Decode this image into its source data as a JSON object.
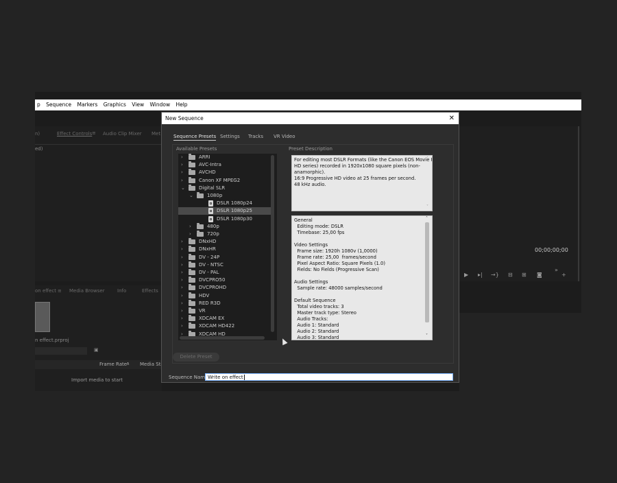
{
  "menubar": {
    "items": [
      "p",
      "Sequence",
      "Markers",
      "Graphics",
      "View",
      "Window",
      "Help"
    ]
  },
  "background": {
    "panel_tabs_top": [
      "n)",
      "Effect Controls",
      "Audio Clip Mixer",
      "Met"
    ],
    "panel_top_label": "ed)",
    "panel_tabs_bottom": [
      "on effect",
      "Media Browser",
      "Info",
      "Effects"
    ],
    "project_file": "n effect.prproj",
    "column_frame_rate": "Frame Rate",
    "column_media_start": "Media Star",
    "import_hint": "Import media to start",
    "timecode": "00;00;00;00"
  },
  "dialog": {
    "title": "New Sequence",
    "close": "✕",
    "tabs": [
      "Sequence Presets",
      "Settings",
      "Tracks",
      "VR Video"
    ],
    "available_presets_label": "Available Presets",
    "preset_description_label": "Preset Description",
    "tree": [
      {
        "label": "ARRI",
        "type": "folder",
        "level": 0,
        "expanded": false
      },
      {
        "label": "AVC-Intra",
        "type": "folder",
        "level": 0,
        "expanded": false
      },
      {
        "label": "AVCHD",
        "type": "folder",
        "level": 0,
        "expanded": false
      },
      {
        "label": "Canon XF MPEG2",
        "type": "folder",
        "level": 0,
        "expanded": false
      },
      {
        "label": "Digital SLR",
        "type": "folder",
        "level": 0,
        "expanded": true
      },
      {
        "label": "1080p",
        "type": "folder",
        "level": 1,
        "expanded": true
      },
      {
        "label": "DSLR 1080p24",
        "type": "file",
        "level": 2
      },
      {
        "label": "DSLR 1080p25",
        "type": "file",
        "level": 2,
        "selected": true
      },
      {
        "label": "DSLR 1080p30",
        "type": "file",
        "level": 2
      },
      {
        "label": "480p",
        "type": "folder",
        "level": 1,
        "expanded": false
      },
      {
        "label": "720p",
        "type": "folder",
        "level": 1,
        "expanded": false
      },
      {
        "label": "DNxHD",
        "type": "folder",
        "level": 0,
        "expanded": false
      },
      {
        "label": "DNxHR",
        "type": "folder",
        "level": 0,
        "expanded": false
      },
      {
        "label": "DV - 24P",
        "type": "folder",
        "level": 0,
        "expanded": false
      },
      {
        "label": "DV - NTSC",
        "type": "folder",
        "level": 0,
        "expanded": false
      },
      {
        "label": "DV - PAL",
        "type": "folder",
        "level": 0,
        "expanded": false
      },
      {
        "label": "DVCPRO50",
        "type": "folder",
        "level": 0,
        "expanded": false
      },
      {
        "label": "DVCPROHD",
        "type": "folder",
        "level": 0,
        "expanded": false
      },
      {
        "label": "HDV",
        "type": "folder",
        "level": 0,
        "expanded": false
      },
      {
        "label": "RED R3D",
        "type": "folder",
        "level": 0,
        "expanded": false
      },
      {
        "label": "VR",
        "type": "folder",
        "level": 0,
        "expanded": false
      },
      {
        "label": "XDCAM EX",
        "type": "folder",
        "level": 0,
        "expanded": false
      },
      {
        "label": "XDCAM HD422",
        "type": "folder",
        "level": 0,
        "expanded": false
      },
      {
        "label": "XDCAM HD",
        "type": "folder",
        "level": 0,
        "expanded": false
      }
    ],
    "description_lines": [
      "For editing most DSLR Formats (like the Canon EOS Movie Full",
      "HD series) recorded in 1920x1080 square pixels (non-",
      "anamorphic).",
      "16:9 Progressive HD video at 25 frames per second.",
      "48 kHz audio."
    ],
    "details_lines": [
      "General",
      "  Editing mode: DSLR",
      "  Timebase: 25,00 fps",
      "",
      "Video Settings",
      "  Frame size: 1920h 1080v (1,0000)",
      "  Frame rate: 25,00  frames/second",
      "  Pixel Aspect Ratio: Square Pixels (1.0)",
      "  Fields: No Fields (Progressive Scan)",
      "",
      "Audio Settings",
      "  Sample rate: 48000 samples/second",
      "",
      "Default Sequence",
      "  Total video tracks: 3",
      "  Master track type: Stereo",
      "  Audio Tracks:",
      "  Audio 1: Standard",
      "  Audio 2: Standard",
      "  Audio 3: Standard"
    ],
    "delete_preset": "Delete Preset",
    "sequence_name_label": "Sequence Name:",
    "sequence_name_value": "Write on effect"
  }
}
